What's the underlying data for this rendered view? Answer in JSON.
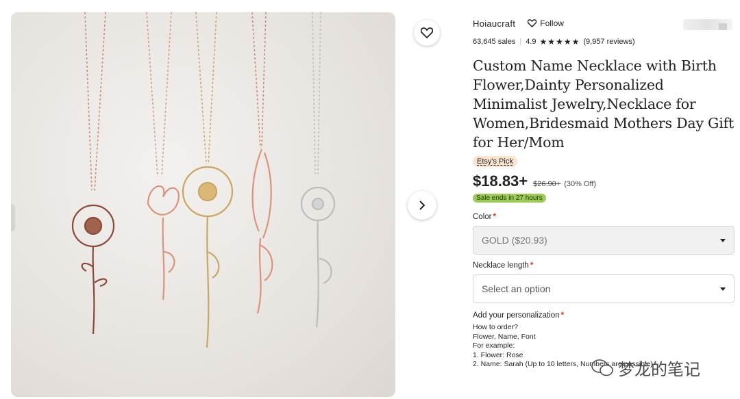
{
  "shop": {
    "name": "Hoiaucraft",
    "follow_label": "Follow",
    "sales": "63,645 sales",
    "rating": "4.9",
    "stars": "★★★★★",
    "reviews": "(9,957 reviews)"
  },
  "product": {
    "title": "Custom Name Necklace with Birth Flower,Dainty Personalized Minimalist Jewelry,Necklace for Women,Bridesmaid Mothers Day Gift for Her/Mom",
    "badge": "Etsy's Pick",
    "price": "$18.83+",
    "old_price": "$26.90+",
    "discount": "(30% Off)",
    "sale_note": "Sale ends in 27 hours"
  },
  "options": {
    "color_label": "Color",
    "color_value": "GOLD ($20.93)",
    "length_label": "Necklace length",
    "length_placeholder": "Select an option",
    "personalization_label": "Add your personalization",
    "instructions": [
      "How to order?",
      "Flower, Name, Font",
      "For example:",
      "1. Flower: Rose",
      "2. Name: Sarah (Up to 10 letters, Numbers are possible)"
    ]
  },
  "watermark": "梦龙的笔记",
  "colors": {
    "rose_gold": "#c98a72",
    "gold": "#c9a563",
    "silver": "#c9c9c9",
    "badge_bg": "#fbe4cf",
    "sale_bg": "#9ec95b"
  }
}
